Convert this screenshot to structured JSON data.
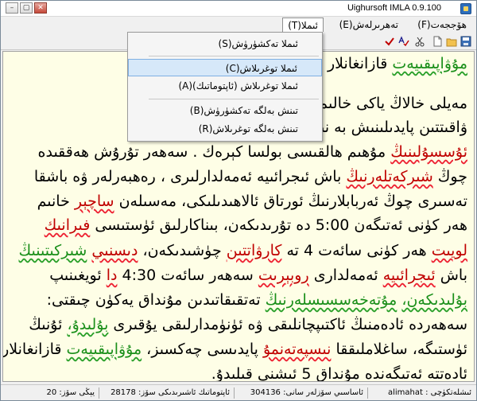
{
  "window": {
    "title": "Uighursoft IMLA 0.9.100",
    "min_label": "–",
    "max_label": "▢",
    "close_label": "✕"
  },
  "menu": {
    "items": [
      {
        "label": "ھۆججەت(F)"
      },
      {
        "label": "تەھرىرلەش(E)"
      },
      {
        "label": "ئىملا(T)"
      }
    ]
  },
  "toolbar": {
    "icons": [
      "save-icon",
      "open-icon",
      "new-document-icon",
      "cut-icon",
      "spellcheck-icon",
      "check-icon"
    ]
  },
  "dropdown": {
    "items": [
      {
        "label": "ئىملا تەكشۈرۈش(S)"
      },
      {
        "label": "ئىملا توغرىلاش(C)"
      },
      {
        "label": "ئىملا توغرىلاش (ئاپتوماتىك)(A)"
      },
      {
        "label": "تىنش بەلگە تەكشۈرۈش(B)"
      },
      {
        "label": "تىنش بەلگە توغرىلاش(R)"
      }
    ],
    "selected_index": 1
  },
  "editor": {
    "lines": [
      [
        {
          "t": "مۇۋاپىقىيەت",
          "c": "green"
        },
        {
          "t": " قازانغانلار ئ"
        }
      ],
      [
        {
          "t": "مەيلى خالاڭ ياكى خالىم"
        },
        {
          "t": "                             "
        },
        {
          "t": "ى ئەتىگەنلىك"
        }
      ],
      [
        {
          "t": "ۋاقىتتىن پايدىلىنىش بە"
        },
        {
          "t": "                   "
        },
        {
          "t": "نىدۇ. ساغلام تۇرمۇش"
        }
      ],
      [
        {
          "t": "ئۇسسۇلىنىڭ",
          "c": "red"
        },
        {
          "t": " مۇھىم ھالقىسى بولسا كېرەك . سەھەر تۇرۇش ھەققىدە"
        }
      ],
      [
        {
          "t": "چوڭ "
        },
        {
          "t": "شىركەتلەرنىڭ",
          "c": "red"
        },
        {
          "t": " باش ئىجرائىيە ئەمەلدارلىرى ، رەھبەرلەر ۋە باشقا"
        }
      ],
      [
        {
          "t": "تەسىرى چوڭ ئەربابلارنىڭ ئورتاق ئالاھىدىلىكى، مەسىلەن "
        },
        {
          "t": "ساچېر",
          "c": "red"
        },
        {
          "t": " خانىم"
        }
      ],
      [
        {
          "t": "ھەر كۈنى ئەتىگەن 5:00 دە تۇرىدىكەن، بىناكارلىق ئۈستىسى "
        },
        {
          "t": "فىرانىك",
          "c": "red"
        }
      ],
      [
        {
          "t": "لويىت",
          "c": "red"
        },
        {
          "t": " ھەر كۈنى سائەت 4 تە "
        },
        {
          "t": "كارۋاتتىن",
          "c": "red"
        },
        {
          "t": " چۈشىدىكەن، "
        },
        {
          "t": "دىسنىي",
          "c": "red"
        },
        {
          "t": " "
        },
        {
          "t": "شىركىتىنىڭ",
          "c": "green"
        }
      ],
      [
        {
          "t": "باش "
        },
        {
          "t": "ئىجرائىيە",
          "c": "red"
        },
        {
          "t": " ئەمەلدارى "
        },
        {
          "t": "روبېرىت",
          "c": "red"
        },
        {
          "t": " سەھەر سائەت 4:30 "
        },
        {
          "t": "دا",
          "c": "red"
        },
        {
          "t": " ئويغىنىپ"
        }
      ],
      [
        {
          "t": "بۇلىدىكەن،",
          "c": "green"
        },
        {
          "t": " "
        },
        {
          "t": "مۇتەخەسسىسلەرنىڭ",
          "c": "green"
        },
        {
          "t": " تەتقىقاتىدىن مۇنداق يەكۈن چىقتى:"
        }
      ],
      [
        {
          "t": "سەھەردە ئادەمنىڭ ئاكتىپچانلىقى ۋە ئۈنۈمدارلىقى يۇقىرى "
        },
        {
          "t": "بۇلىدۇ،",
          "c": "green"
        },
        {
          "t": " ئۇنىڭ"
        }
      ],
      [
        {
          "t": "ئۈستىگە، ساغلاملىققا "
        },
        {
          "t": "نىسپەتەنمۇ",
          "c": "red"
        },
        {
          "t": " پايدىسى چەكسىز، "
        },
        {
          "t": "مۇۋاپىقىيەت",
          "c": "green"
        },
        {
          "t": " قازانغانلار"
        }
      ],
      [
        {
          "t": "ئادەتتە ئەتىگەندە مۇنداق 5 ئىشنى قىلىدۇ."
        }
      ]
    ]
  },
  "status": {
    "user": "ئىشلەتكۈچى : alimahat",
    "words": "ئاساسىي سۆزلەر سانى: 304136",
    "auto_words": "ئاپتوماتىك ئاشىرىدىكى سۆز: 28178",
    "new_words": "يېڭى سۆز: 20"
  }
}
